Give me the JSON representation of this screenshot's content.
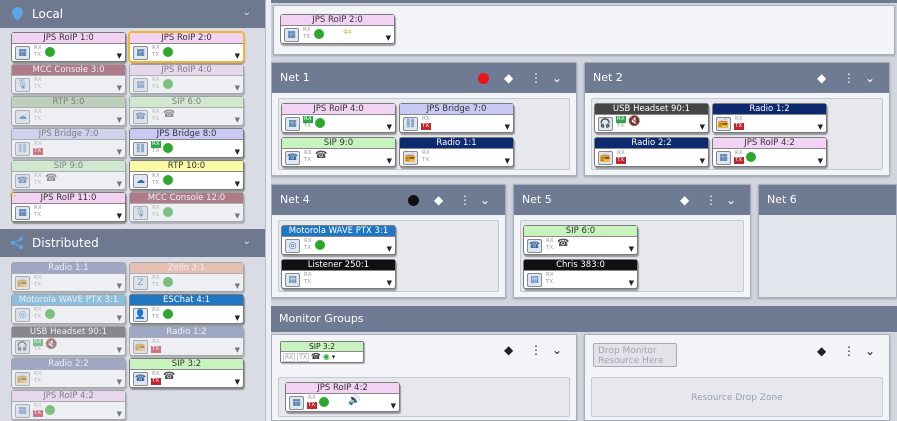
{
  "left": {
    "local_title": "Local",
    "distributed_title": "Distributed"
  },
  "local_tiles": [
    {
      "label": "JPS RoIP 1:0",
      "color": "c-pink",
      "rx": false,
      "tx": false,
      "status": "green-dot",
      "icon": "radio-gateway-icon"
    },
    {
      "label": "JPS RoIP 2:0",
      "color": "c-pink",
      "rx": false,
      "tx": false,
      "status": "green-dot",
      "icon": "radio-gateway-icon",
      "selected": true
    },
    {
      "label": "MCC Console 3:0",
      "color": "c-maroon",
      "dim": true,
      "status": "none",
      "icon": "microphone-icon"
    },
    {
      "label": "JPS RoIP 4:0",
      "color": "c-pink",
      "dim": true,
      "status": "green-dot",
      "icon": "radio-gateway-icon"
    },
    {
      "label": "RTP 5:0",
      "color": "c-olive",
      "dim": true,
      "status": "none",
      "icon": "stream-icon"
    },
    {
      "label": "SIP 6:0",
      "color": "c-green",
      "dim": true,
      "status": "phone",
      "icon": "sip-phone-icon"
    },
    {
      "label": "JPS Bridge 7:0",
      "color": "c-purple",
      "dim": true,
      "status": "none",
      "icon": "link-icon",
      "tx": true
    },
    {
      "label": "JPS Bridge 8:0",
      "color": "c-purple",
      "rx": true,
      "status": "green-dot",
      "icon": "link-icon"
    },
    {
      "label": "SIP 9:0",
      "color": "c-green",
      "dim": true,
      "status": "phone",
      "icon": "sip-phone-icon"
    },
    {
      "label": "RTP 10:0",
      "color": "c-yellow",
      "status": "green-dot",
      "icon": "stream-icon"
    },
    {
      "label": "JPS RoIP 11:0",
      "color": "c-pink",
      "status": "none",
      "icon": "radio-gateway-icon",
      "warn": true
    },
    {
      "label": "MCC Console 12:0",
      "color": "c-maroon",
      "dim": true,
      "status": "green-dot",
      "icon": "microphone-icon"
    }
  ],
  "dist_tiles": [
    {
      "label": "Radio 1:1",
      "color": "c-slate",
      "dim": true,
      "status": "none",
      "icon": "radio-icon"
    },
    {
      "label": "Zello 2:1",
      "color": "c-salmon",
      "dim": true,
      "status": "green-dot",
      "icon": "zello-icon"
    },
    {
      "label": "Motorola WAVE PTX 3:1",
      "color": "c-lblue",
      "dim": true,
      "status": "green-dot",
      "icon": "wave-icon"
    },
    {
      "label": "ESChat 4:1",
      "color": "c-blue",
      "status": "green-dot",
      "icon": "eschat-icon"
    },
    {
      "label": "USB Headset 90:1",
      "color": "c-dark",
      "dim": true,
      "rx": true,
      "status": "mute",
      "icon": "headset-icon"
    },
    {
      "label": "Radio 1:2",
      "color": "c-slate",
      "dim": true,
      "tx": true,
      "status": "none",
      "icon": "radio-icon"
    },
    {
      "label": "Radio 2:2",
      "color": "c-slate",
      "dim": true,
      "status": "none",
      "icon": "radio-icon"
    },
    {
      "label": "SIP 3:2",
      "color": "c-green",
      "tx": true,
      "status": "phone",
      "icon": "sip-phone-icon"
    },
    {
      "label": "JPS RoIP 4:2",
      "color": "c-pink",
      "dim": true,
      "tx": true,
      "status": "green-dot",
      "icon": "radio-gateway-icon"
    }
  ],
  "top_tile": {
    "label": "JPS RoIP 2:0",
    "status": "green-dot",
    "extra": "⇦"
  },
  "nets": {
    "net1": {
      "title": "Net 1"
    },
    "net2": {
      "title": "Net 2"
    },
    "net4": {
      "title": "Net 4"
    },
    "net5": {
      "title": "Net 5"
    },
    "net6": {
      "title": "Net 6"
    }
  },
  "net1_tiles": [
    {
      "label": "JPS RoIP 4:0",
      "color": "c-pink",
      "rx": true,
      "status": "green-dot",
      "icon": "radio-gateway-icon"
    },
    {
      "label": "JPS Bridge 7:0",
      "color": "c-purple",
      "tx": true,
      "status": "none",
      "icon": "link-icon"
    },
    {
      "label": "SIP 9:0",
      "color": "c-green",
      "status": "phone",
      "icon": "sip-phone-icon"
    },
    {
      "label": "Radio 1:1",
      "color": "c-navy",
      "status": "none",
      "icon": "radio-icon"
    }
  ],
  "net2_tiles": [
    {
      "label": "USB Headset 90:1",
      "color": "c-dark",
      "rx": true,
      "status": "mute",
      "icon": "headset-icon"
    },
    {
      "label": "Radio 1:2",
      "color": "c-navy",
      "tx": true,
      "status": "none",
      "icon": "radio-icon"
    },
    {
      "label": "Radio 2:2",
      "color": "c-navy",
      "tx": true,
      "status": "none",
      "icon": "radio-icon"
    },
    {
      "label": "JPS RoIP 4:2",
      "color": "c-pink",
      "tx": true,
      "status": "green-dot",
      "icon": "radio-gateway-icon"
    }
  ],
  "net4_tiles": [
    {
      "label": "Motorola WAVE PTX 3:1",
      "color": "c-blue",
      "status": "green-dot",
      "icon": "wave-icon"
    },
    {
      "label": "Listener 250:1",
      "color": "c-black",
      "status": "none",
      "icon": "listener-icon"
    }
  ],
  "net5_tiles": [
    {
      "label": "SIP 6:0",
      "color": "c-green",
      "status": "phone",
      "icon": "sip-phone-icon"
    },
    {
      "label": "Chris 383:0",
      "color": "c-black",
      "status": "none",
      "icon": "listener-icon"
    }
  ],
  "monitor": {
    "title": "Monitor Groups",
    "sip_chip": "SIP 3:2",
    "tile": {
      "label": "JPS RoIP 4:2",
      "color": "c-pink",
      "tx": true,
      "status": "green-dot",
      "icon": "radio-gateway-icon",
      "extra": "🔊"
    },
    "drop_button": "Drop Monitor Resource Here",
    "drop_zone": "Resource Drop Zone"
  },
  "labels": {
    "rx": "RX",
    "tx": "TX"
  },
  "colors": {
    "header": "#6f7b92",
    "record": "#e8141c",
    "green": "#2fa72f",
    "warn": "#f3b42f"
  }
}
